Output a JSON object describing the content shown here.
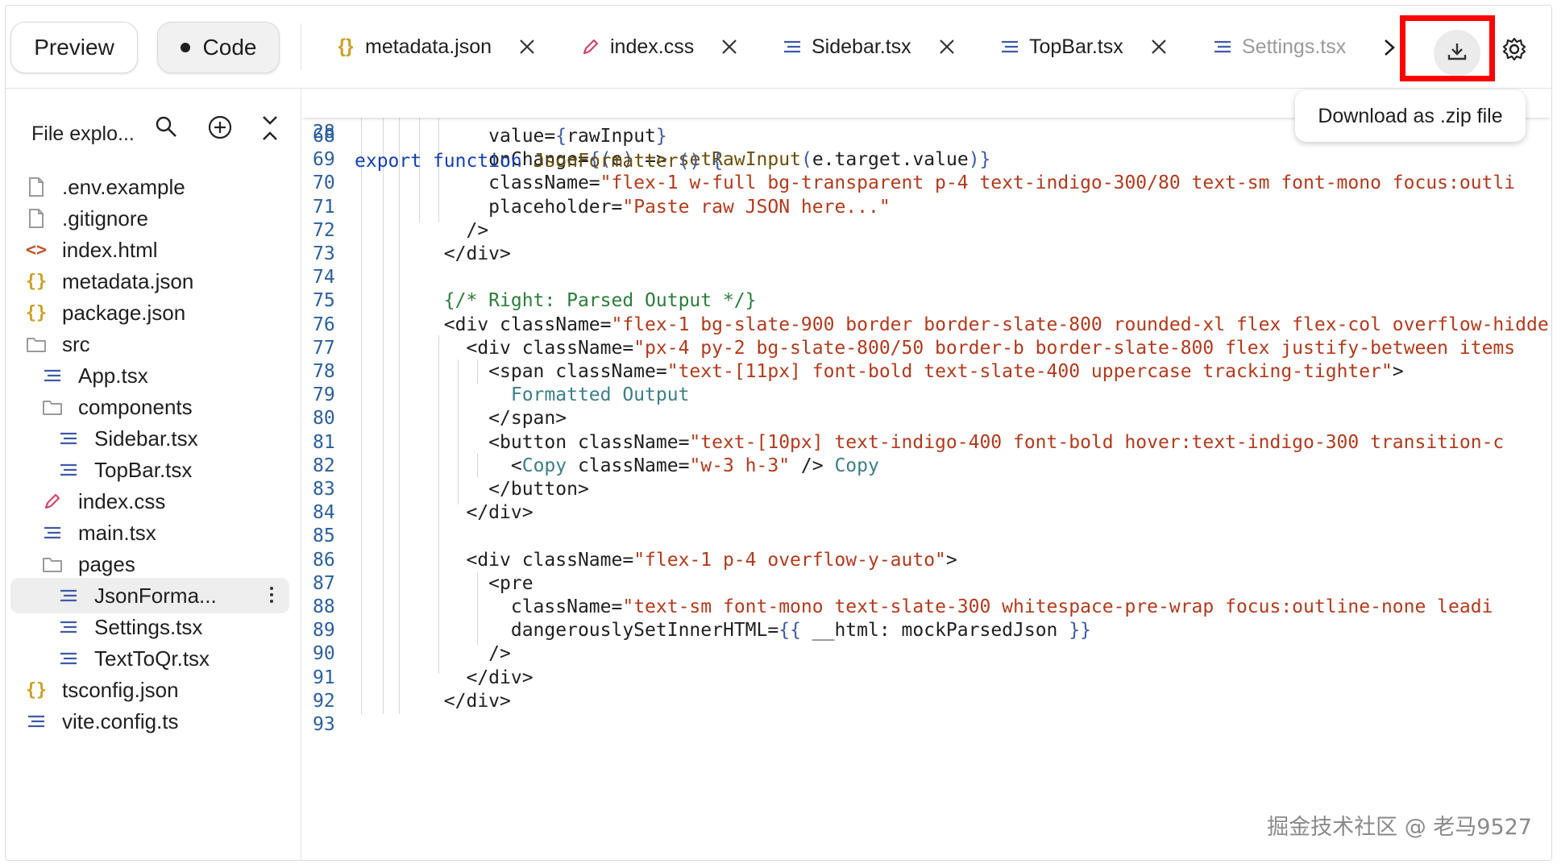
{
  "topbar": {
    "preview_label": "Preview",
    "code_label": "Code",
    "tabs": [
      {
        "label": "metadata.json",
        "icon": "braces-icon"
      },
      {
        "label": "index.css",
        "icon": "pencil-icon"
      },
      {
        "label": "Sidebar.tsx",
        "icon": "lines-icon"
      },
      {
        "label": "TopBar.tsx",
        "icon": "lines-icon"
      },
      {
        "label": "Settings.tsx",
        "icon": "lines-icon"
      }
    ],
    "tooltip": "Download as .zip file",
    "colors": {
      "highlight_box": "#ff0000",
      "json_icon": "#c9a227",
      "css_icon": "#d1456a",
      "file_icon": "#3f59a8"
    }
  },
  "sidebar": {
    "title": "File explo...",
    "files": [
      {
        "name": ".env.example",
        "icon": "file-icon",
        "depth": 0
      },
      {
        "name": ".gitignore",
        "icon": "file-icon",
        "depth": 0
      },
      {
        "name": "index.html",
        "icon": "code-icon",
        "depth": 0
      },
      {
        "name": "metadata.json",
        "icon": "braces-icon",
        "depth": 0
      },
      {
        "name": "package.json",
        "icon": "braces-icon",
        "depth": 0
      },
      {
        "name": "src",
        "icon": "folder-icon",
        "depth": 0
      },
      {
        "name": "App.tsx",
        "icon": "lines-icon",
        "depth": 1
      },
      {
        "name": "components",
        "icon": "folder-icon",
        "depth": 1
      },
      {
        "name": "Sidebar.tsx",
        "icon": "lines-icon",
        "depth": 2
      },
      {
        "name": "TopBar.tsx",
        "icon": "lines-icon",
        "depth": 2
      },
      {
        "name": "index.css",
        "icon": "pencil-icon",
        "depth": 1
      },
      {
        "name": "main.tsx",
        "icon": "lines-icon",
        "depth": 1
      },
      {
        "name": "pages",
        "icon": "folder-icon",
        "depth": 1
      },
      {
        "name": "JsonForma...",
        "icon": "lines-icon",
        "depth": 2,
        "selected": true
      },
      {
        "name": "Settings.tsx",
        "icon": "lines-icon",
        "depth": 2
      },
      {
        "name": "TextToQr.tsx",
        "icon": "lines-icon",
        "depth": 2
      },
      {
        "name": "tsconfig.json",
        "icon": "braces-icon",
        "depth": 0
      },
      {
        "name": "vite.config.ts",
        "icon": "lines-icon",
        "depth": 0
      }
    ]
  },
  "editor": {
    "sticky": {
      "num": "28",
      "text": "export function JsonFormatter() {"
    },
    "lines": [
      {
        "num": "68",
        "text": "            value={rawInput}"
      },
      {
        "num": "69",
        "text": "            onChange={(e) => setRawInput(e.target.value)}"
      },
      {
        "num": "70",
        "text": "            className=\"flex-1 w-full bg-transparent p-4 text-indigo-300/80 text-sm font-mono focus:outli"
      },
      {
        "num": "71",
        "text": "            placeholder=\"Paste raw JSON here...\""
      },
      {
        "num": "72",
        "text": "          />"
      },
      {
        "num": "73",
        "text": "        </div>"
      },
      {
        "num": "74",
        "text": ""
      },
      {
        "num": "75",
        "text": "        {/* Right: Parsed Output */}"
      },
      {
        "num": "76",
        "text": "        <div className=\"flex-1 bg-slate-900 border border-slate-800 rounded-xl flex flex-col overflow-hidde"
      },
      {
        "num": "77",
        "text": "          <div className=\"px-4 py-2 bg-slate-800/50 border-b border-slate-800 flex justify-between items"
      },
      {
        "num": "78",
        "text": "            <span className=\"text-[11px] font-bold text-slate-400 uppercase tracking-tighter\">"
      },
      {
        "num": "79",
        "text": "              Formatted Output"
      },
      {
        "num": "80",
        "text": "            </span>"
      },
      {
        "num": "81",
        "text": "            <button className=\"text-[10px] text-indigo-400 font-bold hover:text-indigo-300 transition-c"
      },
      {
        "num": "82",
        "text": "              <Copy className=\"w-3 h-3\" /> Copy"
      },
      {
        "num": "83",
        "text": "            </button>"
      },
      {
        "num": "84",
        "text": "          </div>"
      },
      {
        "num": "85",
        "text": ""
      },
      {
        "num": "86",
        "text": "          <div className=\"flex-1 p-4 overflow-y-auto\">"
      },
      {
        "num": "87",
        "text": "            <pre"
      },
      {
        "num": "88",
        "text": "              className=\"text-sm font-mono text-slate-300 whitespace-pre-wrap focus:outline-none leadi"
      },
      {
        "num": "89",
        "text": "              dangerouslySetInnerHTML={{ __html: mockParsedJson }}"
      },
      {
        "num": "90",
        "text": "            />"
      },
      {
        "num": "91",
        "text": "          </div>"
      },
      {
        "num": "92",
        "text": "        </div>"
      },
      {
        "num": "93",
        "text": ""
      }
    ]
  },
  "watermark": "掘金技术社区 @ 老马9527"
}
